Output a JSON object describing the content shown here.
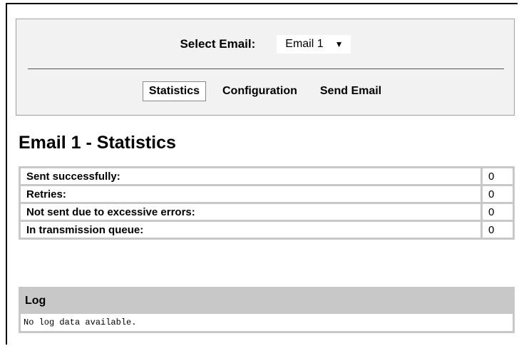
{
  "selector": {
    "label": "Select Email:",
    "selected": "Email 1"
  },
  "tabs": [
    {
      "label": "Statistics",
      "active": true
    },
    {
      "label": "Configuration",
      "active": false
    },
    {
      "label": "Send Email",
      "active": false
    }
  ],
  "page_title": "Email 1 - Statistics",
  "stats": [
    {
      "label": "Sent successfully:",
      "value": "0"
    },
    {
      "label": "Retries:",
      "value": "0"
    },
    {
      "label": "Not sent due to excessive errors:",
      "value": "0"
    },
    {
      "label": "In transmission queue:",
      "value": "0"
    }
  ],
  "log": {
    "title": "Log",
    "message": "No log data available."
  }
}
